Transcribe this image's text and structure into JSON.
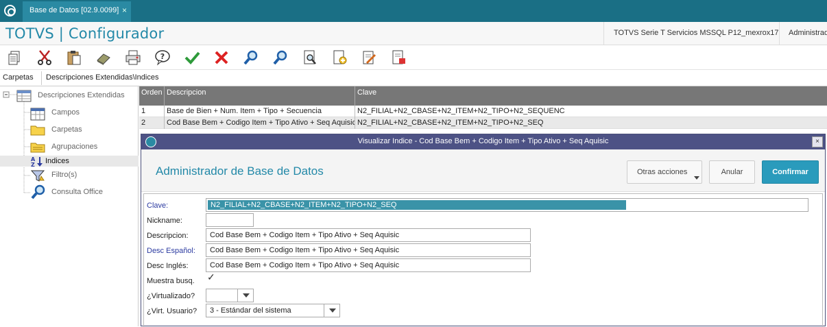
{
  "window": {
    "tab_label": "Base de Datos [02.9.0099]",
    "tab_close": "×"
  },
  "header": {
    "app_title": "TOTVS | Configurador",
    "environment": "TOTVS Serie T Servicios MSSQL P12_mexrox17",
    "user": "Administrad"
  },
  "toolbar": {
    "icons": [
      "copy-icon",
      "cut-icon",
      "paste-icon",
      "eraser-icon",
      "print-icon",
      "help-icon",
      "confirm-check-icon",
      "cancel-x-icon",
      "search-icon",
      "search-next-icon",
      "preview-icon",
      "new-document-icon",
      "edit-icon",
      "delete-document-icon"
    ]
  },
  "pathbar": {
    "label": "Carpetas",
    "path": "Descripciones Extendidas\\Indices"
  },
  "tree": {
    "root": "Descripciones Extendidas",
    "items": [
      "Campos",
      "Carpetas",
      "Agrupaciones",
      "Indices",
      "Filtro(s)",
      "Consulta Office"
    ],
    "selected_index": 3
  },
  "grid": {
    "headers": [
      "Orden",
      "Descripcion",
      "Clave"
    ],
    "rows": [
      [
        "1",
        "Base de Bien + Num. Item + Tipo + Secuencia",
        "N2_FILIAL+N2_CBASE+N2_ITEM+N2_TIPO+N2_SEQUENC"
      ],
      [
        "2",
        "Cod Base Bem + Codigo Item + Tipo Ativo + Seq Aquisic",
        "N2_FILIAL+N2_CBASE+N2_ITEM+N2_TIPO+N2_SEQ"
      ]
    ]
  },
  "dialog": {
    "title": "Visualizar Indice - Cod Base Bem + Codigo Item + Tipo Ativo + Seq Aquisic",
    "close": "×",
    "heading": "Administrador de Base de Datos",
    "btn_other": "Otras acciones",
    "btn_cancel": "Anular",
    "btn_confirm": "Confirmar",
    "fields": {
      "clave_label": "Clave:",
      "clave_value": "N2_FILIAL+N2_CBASE+N2_ITEM+N2_TIPO+N2_SEQ",
      "nickname_label": "Nickname:",
      "nickname_value": "",
      "descripcion_label": "Descripcion:",
      "descripcion_value": "Cod Base Bem + Codigo Item + Tipo Ativo + Seq Aquisic",
      "desc_es_label": "Desc Español:",
      "desc_es_value": "Cod Base Bem + Codigo Item + Tipo Ativo + Seq Aquisic",
      "desc_en_label": "Desc Inglés:",
      "desc_en_value": "Cod Base Bem + Codigo Item + Tipo Ativo + Seq Aquisic",
      "muestra_label": "Muestra busq.",
      "muestra_checked": true,
      "check_glyph": "✓",
      "virtualizado_label": "¿Virtualizado?",
      "virtualizado_value": "",
      "virt_usuario_label": "¿Virt. Usuario?",
      "virt_usuario_value": "3 - Estándar del sistema"
    }
  },
  "colors": {
    "titlebar": "#1a6f85",
    "accent": "#2389a8",
    "dialog_title": "#4d5285",
    "confirm": "#2a9bbc"
  }
}
